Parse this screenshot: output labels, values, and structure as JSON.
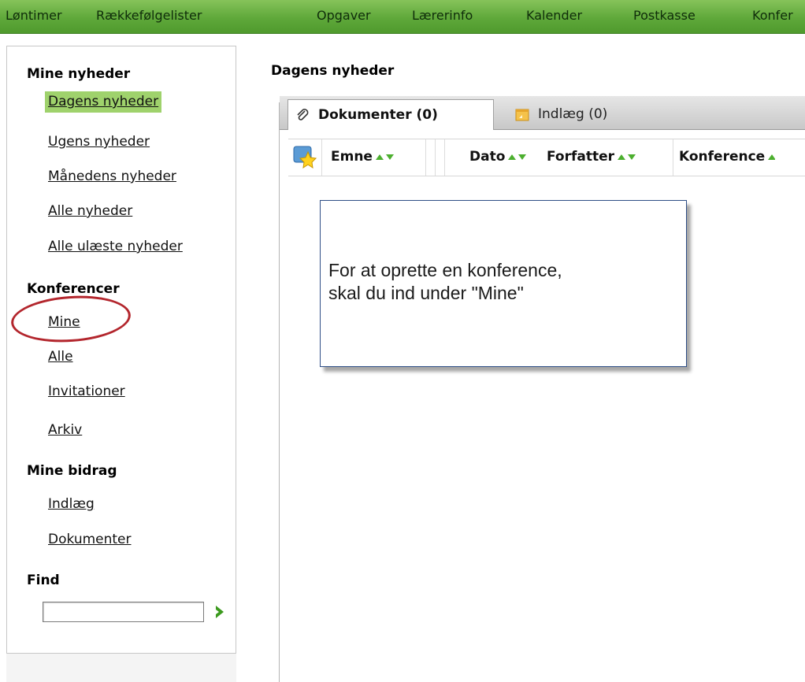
{
  "topnav": {
    "items": [
      "Løntimer",
      "Rækkefølgelister",
      "Opgaver",
      "Lærerinfo",
      "Kalender",
      "Postkasse",
      "Konfer"
    ]
  },
  "sidebar": {
    "section_news": "Mine nyheder",
    "news_links": [
      "Dagens nyheder",
      "Ugens nyheder",
      "Månedens nyheder",
      "Alle nyheder",
      "Alle ulæste nyheder"
    ],
    "active_news": "Dagens nyheder",
    "section_conferences": "Konferencer",
    "conference_links": [
      "Mine",
      "Alle",
      "Invitationer",
      "Arkiv"
    ],
    "section_contrib": "Mine bidrag",
    "contrib_links": [
      "Indlæg",
      "Dokumenter"
    ],
    "section_find": "Find",
    "find_value": ""
  },
  "main": {
    "title": "Dagens nyheder",
    "tabs": [
      {
        "label": "Dokumenter (0)",
        "icon": "paperclip-icon",
        "active": true
      },
      {
        "label": "Indlæg (0)",
        "icon": "note-icon",
        "active": false
      }
    ],
    "columns": [
      "Emne",
      "Dato",
      "Forfatter",
      "Konference"
    ]
  },
  "callout": {
    "line1": "For at oprette en konference,",
    "line2": "skal du ind under \"Mine\""
  },
  "colors": {
    "nav_green": "#5fa83a",
    "active_highlight": "#9fd26c",
    "annotation_red": "#b3262d",
    "callout_border": "#2e4e86"
  }
}
